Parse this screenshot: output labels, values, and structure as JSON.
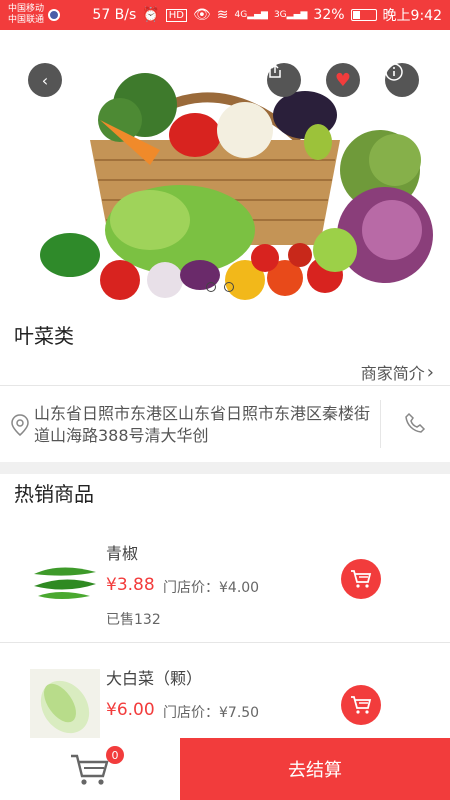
{
  "status_bar": {
    "carrier1": "中国移动",
    "carrier2": "中国联通",
    "speed": "57 B/s",
    "signal1": "4G",
    "signal2": "3G",
    "battery": "32%",
    "time": "晚上9:42"
  },
  "hero": {
    "back_icon": "back-arrow-icon",
    "share_icon": "share-icon",
    "favorite_icon": "heart-icon",
    "info_icon": "info-icon",
    "slides": 2
  },
  "shop": {
    "name": "叶菜类",
    "intro_label": "商家简介",
    "address": "山东省日照市东港区山东省日照市东港区秦楼街道山海路388号清大华创"
  },
  "hot_products": {
    "title": "热销商品",
    "items": [
      {
        "name": "青椒",
        "price": "¥3.88",
        "store_price": "门店价：¥4.00",
        "sold": "已售132",
        "image": "green-pepper"
      },
      {
        "name": "大白菜（颗）",
        "price": "¥6.00",
        "store_price": "门店价：¥7.50",
        "sold": "",
        "image": "napa-cabbage"
      }
    ]
  },
  "bottom_bar": {
    "cart_count": "0",
    "checkout_label": "去结算"
  },
  "colors": {
    "accent": "#f23c3c",
    "icon_bg": "#555555"
  }
}
